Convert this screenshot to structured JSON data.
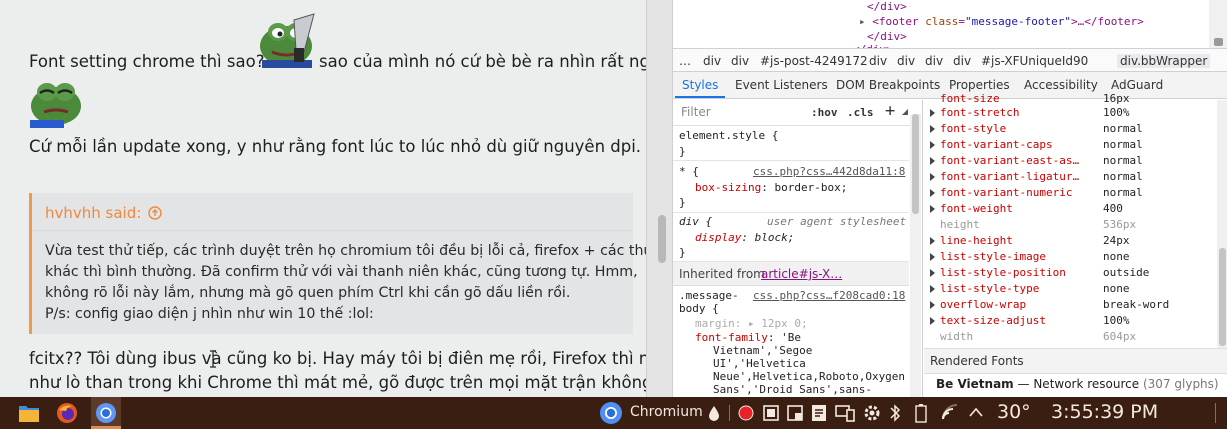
{
  "forum": {
    "line1_before": "Font setting chrome thì sao??",
    "line1_after": "sao của mình nó cứ bè bè ra nhìn rất ngu",
    "line2": "Cứ mỗi lần update xong, y như rằng font lúc to lúc nhỏ dù giữ nguyên dpi.",
    "quote": {
      "author": "hvhvhh said:",
      "lines": [
        "Vừa test thử tiếp, các trình duyệt trên họ chromium tôi đều bị lỗi cả, firefox + các thứ",
        "khác thì bình thường. Đã confirm thử với vài thanh niên khác, cũng tương tự. Hmm,",
        "không rõ lỗi này lắm, nhưng mà gõ quen phím Ctrl khi cần gõ dấu liền rồi.",
        "P/s: config giao diện j nhìn như win 10 thế :lol:"
      ]
    },
    "reply_line1": "fcitx?? Tôi dùng ibus và cũng ko bị. Hay máy tôi bị điên mẹ rồi, Firefox thì nóng",
    "reply_line2": "như lò than trong khi Chrome thì mát mẻ, gõ được trên mọi mặt trận không lỗi"
  },
  "devtools": {
    "dom": {
      "close_div_1": "</div>",
      "footer_open": "<footer",
      "footer_attr": "class",
      "footer_val": "\"message-footer\"",
      "footer_rest": ">…</footer>",
      "close_div_2": "</div>",
      "close_div_3": "</div>"
    },
    "breadcrumbs": [
      "…",
      "div",
      "div",
      "#js-post-4249172",
      "div",
      "div",
      "div",
      "div",
      "#js-XFUniqueId90",
      "div.bbWrapper"
    ],
    "tabs": [
      "Styles",
      "Event Listeners",
      "DOM Breakpoints",
      "Properties",
      "Accessibility",
      "AdGuard"
    ],
    "styles": {
      "filter_placeholder": "Filter",
      "hov": ":hov",
      "cls": ".cls",
      "element_style": "element.style {",
      "close_brace": "}",
      "star_sel": "* {",
      "star_src": "css.php?css…442d8da11:8",
      "box_sizing_name": "box-sizing",
      "box_sizing_value": "border-box;",
      "div_sel": "div {",
      "div_src": "user agent stylesheet",
      "display_name": "display",
      "display_value": "block;",
      "inherited_label": "Inherited from",
      "inherited_link": "article#js-X…",
      "msg_sel_1": ".message-",
      "msg_sel_2": "body {",
      "msg_src": "css.php?css…f208cad0:18",
      "margin_name": "margin",
      "margin_value": "12px 0;",
      "ff_name": "font-family",
      "ff_v1": "'Be",
      "ff_v2": "Vietnam','Segoe",
      "ff_v3": "UI','Helvetica",
      "ff_v4": "Neue',Helvetica,Roboto,Oxygen",
      "ff_v5": "Sans','Droid Sans',sans-"
    },
    "computed": {
      "top_partial": "font-size",
      "top_partial_value": "16px",
      "rows": [
        {
          "name": "font-stretch",
          "value": "100%",
          "inherited": false
        },
        {
          "name": "font-style",
          "value": "normal",
          "inherited": false
        },
        {
          "name": "font-variant-caps",
          "value": "normal",
          "inherited": false
        },
        {
          "name": "font-variant-east-as…",
          "value": "normal",
          "inherited": false
        },
        {
          "name": "font-variant-ligatur…",
          "value": "normal",
          "inherited": false
        },
        {
          "name": "font-variant-numeric",
          "value": "normal",
          "inherited": false
        },
        {
          "name": "font-weight",
          "value": "400",
          "inherited": false
        },
        {
          "name": "height",
          "value": "536px",
          "inherited": true
        },
        {
          "name": "line-height",
          "value": "24px",
          "inherited": false
        },
        {
          "name": "list-style-image",
          "value": "none",
          "inherited": false
        },
        {
          "name": "list-style-position",
          "value": "outside",
          "inherited": false
        },
        {
          "name": "list-style-type",
          "value": "none",
          "inherited": false
        },
        {
          "name": "overflow-wrap",
          "value": "break-word",
          "inherited": false
        },
        {
          "name": "text-size-adjust",
          "value": "100%",
          "inherited": false
        },
        {
          "name": "width",
          "value": "604px",
          "inherited": true
        }
      ],
      "rendered_fonts_label": "Rendered Fonts",
      "font_name": "Be Vietnam",
      "font_dash": "—",
      "font_source": "Network resource",
      "font_glyphs": "(307 glyphs)"
    }
  },
  "taskbar": {
    "chromium_label": "Chromium",
    "temperature": "30°",
    "clock": "3:55:39 PM"
  },
  "colors": {
    "accent_orange": "#f29a4a",
    "devtools_blue": "#1a73e8",
    "taskbar_bg": "#3a1e12"
  }
}
